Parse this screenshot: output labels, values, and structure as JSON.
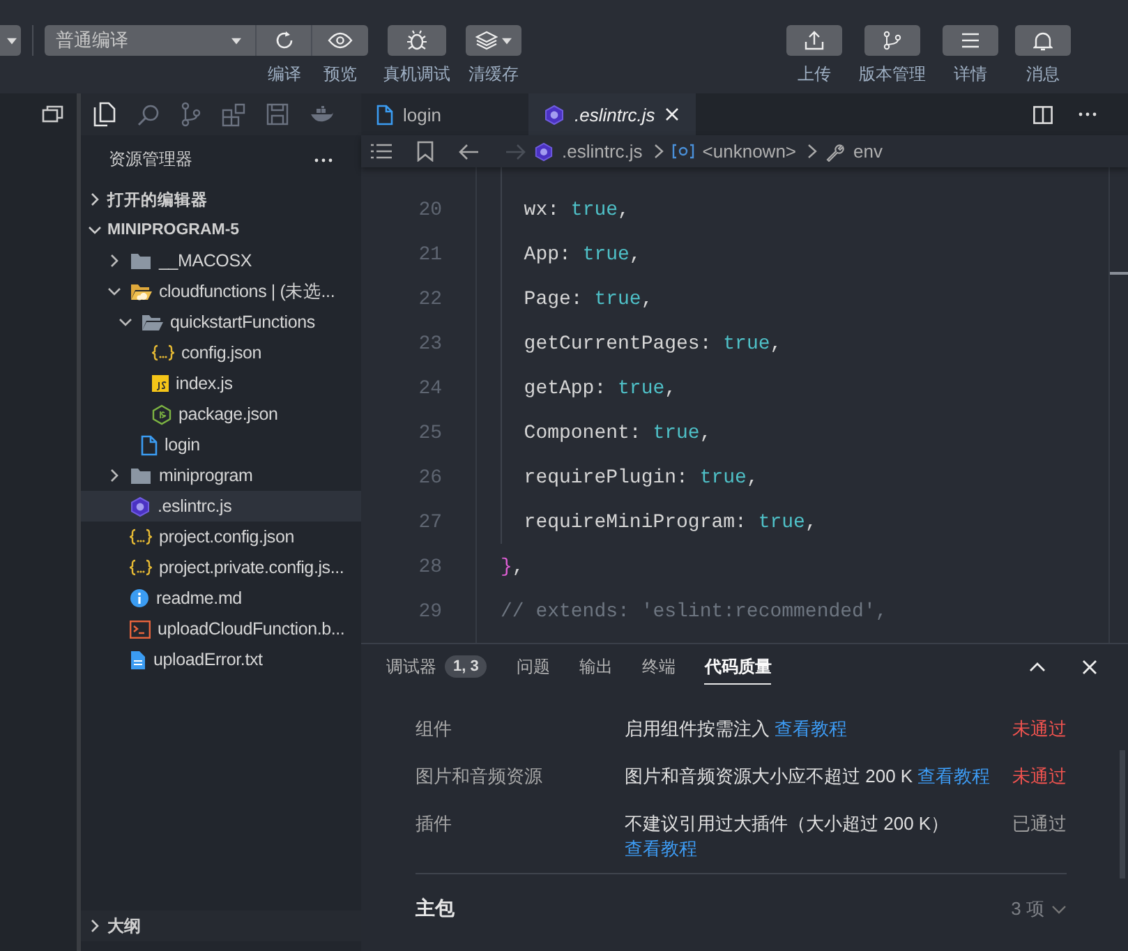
{
  "toolbar": {
    "mode_select": "普通编译",
    "left_tools": [
      {
        "label": "编译"
      },
      {
        "label": "预览"
      },
      {
        "label": "真机调试"
      },
      {
        "label": "清缓存"
      }
    ],
    "right_tools": [
      {
        "label": "上传"
      },
      {
        "label": "版本管理"
      },
      {
        "label": "详情"
      },
      {
        "label": "消息"
      }
    ]
  },
  "explorer": {
    "title": "资源管理器",
    "sections": [
      {
        "title": "打开的编辑器",
        "expanded": false
      },
      {
        "title": "MINIPROGRAM-5",
        "expanded": true,
        "items": [
          {
            "name": "__MACOSX",
            "kind": "folder",
            "expanded": false,
            "selected": false
          },
          {
            "name": "cloudfunctions | (未选...",
            "kind": "cloud-folder",
            "expanded": true,
            "selected": false,
            "children": [
              {
                "name": "quickstartFunctions",
                "kind": "folder",
                "expanded": true,
                "selected": false,
                "children": [
                  {
                    "name": "config.json",
                    "kind": "json",
                    "selected": false
                  },
                  {
                    "name": "index.js",
                    "kind": "js",
                    "selected": false
                  },
                  {
                    "name": "package.json",
                    "kind": "node",
                    "selected": false
                  }
                ]
              },
              {
                "name": "login",
                "kind": "file",
                "selected": false
              }
            ]
          },
          {
            "name": "miniprogram",
            "kind": "folder",
            "expanded": false,
            "selected": false
          },
          {
            "name": ".eslintrc.js",
            "kind": "eslint",
            "selected": true
          },
          {
            "name": "project.config.json",
            "kind": "json",
            "selected": false
          },
          {
            "name": "project.private.config.js...",
            "kind": "json",
            "selected": false
          },
          {
            "name": "readme.md",
            "kind": "info",
            "selected": false
          },
          {
            "name": "uploadCloudFunction.b...",
            "kind": "shell",
            "selected": false
          },
          {
            "name": "uploadError.txt",
            "kind": "text",
            "selected": false
          }
        ]
      }
    ],
    "outline": {
      "title": "大纲",
      "expanded": false
    }
  },
  "editor": {
    "tabs": [
      {
        "label": "login",
        "kind": "file",
        "selected": false,
        "preview": false
      },
      {
        "label": ".eslintrc.js",
        "kind": "eslint",
        "selected": true,
        "preview": true
      }
    ],
    "breadcrumbs": [
      ".eslintrc.js",
      "<unknown>",
      "env"
    ],
    "lines": [
      {
        "number": "20",
        "tokens": [
          {
            "text": "  wx: ",
            "kind": "plain"
          },
          {
            "text": "true",
            "kind": "bool"
          },
          {
            "text": ",",
            "kind": "plain"
          }
        ]
      },
      {
        "number": "21",
        "tokens": [
          {
            "text": "  App: ",
            "kind": "plain"
          },
          {
            "text": "true",
            "kind": "bool"
          },
          {
            "text": ",",
            "kind": "plain"
          }
        ]
      },
      {
        "number": "22",
        "tokens": [
          {
            "text": "  Page: ",
            "kind": "plain"
          },
          {
            "text": "true",
            "kind": "bool"
          },
          {
            "text": ",",
            "kind": "plain"
          }
        ]
      },
      {
        "number": "23",
        "tokens": [
          {
            "text": "  getCurrentPages: ",
            "kind": "plain"
          },
          {
            "text": "true",
            "kind": "bool"
          },
          {
            "text": ",",
            "kind": "plain"
          }
        ]
      },
      {
        "number": "24",
        "tokens": [
          {
            "text": "  getApp: ",
            "kind": "plain"
          },
          {
            "text": "true",
            "kind": "bool"
          },
          {
            "text": ",",
            "kind": "plain"
          }
        ]
      },
      {
        "number": "25",
        "tokens": [
          {
            "text": "  Component: ",
            "kind": "plain"
          },
          {
            "text": "true",
            "kind": "bool"
          },
          {
            "text": ",",
            "kind": "plain"
          }
        ]
      },
      {
        "number": "26",
        "tokens": [
          {
            "text": "  requirePlugin: ",
            "kind": "plain"
          },
          {
            "text": "true",
            "kind": "bool"
          },
          {
            "text": ",",
            "kind": "plain"
          }
        ]
      },
      {
        "number": "27",
        "tokens": [
          {
            "text": "  requireMiniProgram: ",
            "kind": "plain"
          },
          {
            "text": "true",
            "kind": "bool"
          },
          {
            "text": ",",
            "kind": "plain"
          }
        ]
      },
      {
        "number": "28",
        "tokens": [
          {
            "text": "}",
            "kind": "bracket"
          },
          {
            "text": ",",
            "kind": "plain"
          }
        ]
      },
      {
        "number": "29",
        "tokens": [
          {
            "text": "// extends: 'eslint:recommended',",
            "kind": "comment"
          }
        ]
      }
    ]
  },
  "panel": {
    "tabs": [
      {
        "label": "调试器",
        "badge": "1, 3",
        "selected": false
      },
      {
        "label": "问题",
        "selected": false
      },
      {
        "label": "输出",
        "selected": false
      },
      {
        "label": "终端",
        "selected": false
      },
      {
        "label": "代码质量",
        "selected": true
      }
    ],
    "rows": [
      {
        "item": "组件",
        "description": "启用组件按需注入",
        "link": "查看教程",
        "status": "未通过",
        "passed": false
      },
      {
        "item": "图片和音频资源",
        "description": "图片和音频资源大小应不超过 200 K",
        "link": "查看教程",
        "status": "未通过",
        "passed": false
      },
      {
        "item": "插件",
        "description": "不建议引用过大插件（大小超过 200 K）",
        "link": "查看教程",
        "status": "已通过",
        "passed": true
      }
    ],
    "group": {
      "title": "主包",
      "count": "3 项",
      "expanded": false
    }
  }
}
